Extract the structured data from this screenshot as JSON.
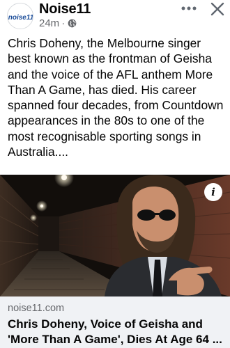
{
  "header": {
    "avatar_text": "Noise11",
    "page_name": "Noise11",
    "time": "24m",
    "separator": "·",
    "audience_icon": "globe-icon",
    "more_icon": "more-horizontal-icon",
    "close_icon": "close-icon"
  },
  "post": {
    "text": "Chris Doheny, the Melbourne singer best known as the frontman of Geisha and the voice of the AFL anthem More Than A Game, has died. His career spanned four decades, from Countdown appearances in the 80s to one of the most recognisable sporting songs in Australia...."
  },
  "link_preview": {
    "image_icon": "info-icon",
    "info_label": "i",
    "domain": "noise11.com",
    "title": "Chris Doheny, Voice of Geisha and 'More Than A Game', Dies At Age 64 ..."
  },
  "colors": {
    "text_primary": "#050505",
    "text_secondary": "#65676b",
    "footer_bg": "#f0f2f5",
    "brand_blue": "#1d4e9a"
  }
}
